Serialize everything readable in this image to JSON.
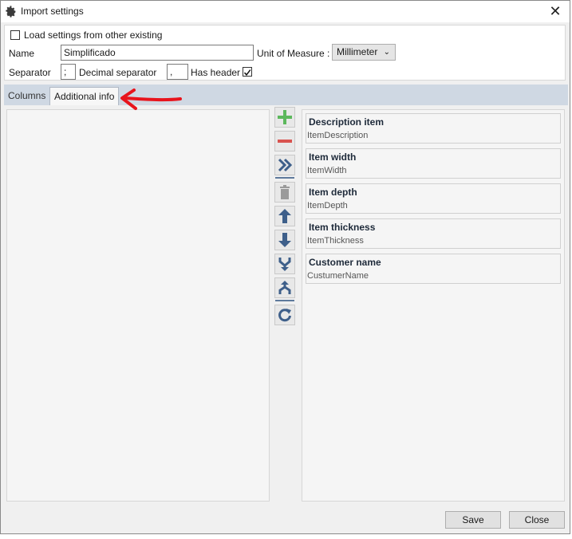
{
  "window": {
    "title": "Import settings",
    "icon": "gear-icon",
    "close_glyph": "✕"
  },
  "settings": {
    "load_existing_label": "Load settings from other existing",
    "load_existing_checked": false,
    "name_label": "Name",
    "name_value": "Simplificado",
    "unit_label": "Unit of Measure :",
    "unit_value": "Millimeter",
    "separator_label": "Separator",
    "separator_value": ";",
    "decimal_label": "Decimal separator",
    "decimal_value": ",",
    "has_header_label": "Has header",
    "has_header_checked": true
  },
  "tabs": [
    {
      "label": "Columns",
      "active": false
    },
    {
      "label": "Additional info",
      "active": true
    }
  ],
  "toolbar": {
    "buttons": [
      "add-icon",
      "remove-icon",
      "move-right-icon",
      "delete-icon",
      "move-up-icon",
      "move-down-icon",
      "merge-icon",
      "split-icon",
      "refresh-icon"
    ],
    "accent": "#3e5f8a",
    "add_color": "#5cb85c",
    "remove_color": "#d9534f"
  },
  "items": [
    {
      "title": "Description item",
      "field": "ItemDescription"
    },
    {
      "title": "Item width",
      "field": "ItemWidth"
    },
    {
      "title": "Item depth",
      "field": "ItemDepth"
    },
    {
      "title": "Item thickness",
      "field": "ItemThickness"
    },
    {
      "title": "Customer name",
      "field": "CustumerName"
    }
  ],
  "footer": {
    "save_label": "Save",
    "close_label": "Close"
  },
  "annotation_color": "#e8141c"
}
